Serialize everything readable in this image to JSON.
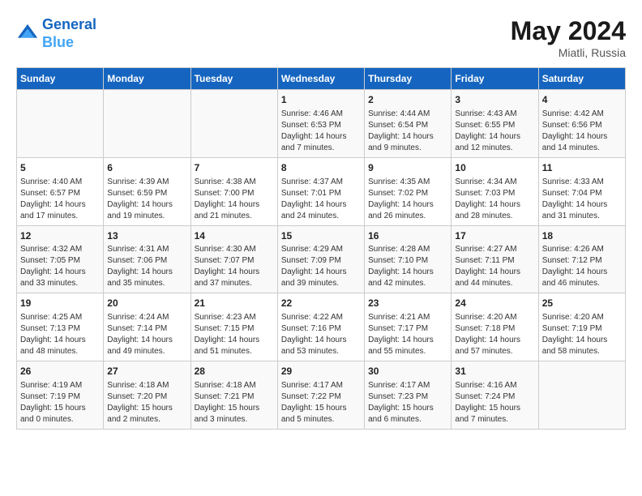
{
  "header": {
    "logo_line1": "General",
    "logo_line2": "Blue",
    "month_title": "May 2024",
    "subtitle": "Miatli, Russia"
  },
  "days_of_week": [
    "Sunday",
    "Monday",
    "Tuesday",
    "Wednesday",
    "Thursday",
    "Friday",
    "Saturday"
  ],
  "weeks": [
    [
      {
        "num": "",
        "info": ""
      },
      {
        "num": "",
        "info": ""
      },
      {
        "num": "",
        "info": ""
      },
      {
        "num": "1",
        "info": "Sunrise: 4:46 AM\nSunset: 6:53 PM\nDaylight: 14 hours\nand 7 minutes."
      },
      {
        "num": "2",
        "info": "Sunrise: 4:44 AM\nSunset: 6:54 PM\nDaylight: 14 hours\nand 9 minutes."
      },
      {
        "num": "3",
        "info": "Sunrise: 4:43 AM\nSunset: 6:55 PM\nDaylight: 14 hours\nand 12 minutes."
      },
      {
        "num": "4",
        "info": "Sunrise: 4:42 AM\nSunset: 6:56 PM\nDaylight: 14 hours\nand 14 minutes."
      }
    ],
    [
      {
        "num": "5",
        "info": "Sunrise: 4:40 AM\nSunset: 6:57 PM\nDaylight: 14 hours\nand 17 minutes."
      },
      {
        "num": "6",
        "info": "Sunrise: 4:39 AM\nSunset: 6:59 PM\nDaylight: 14 hours\nand 19 minutes."
      },
      {
        "num": "7",
        "info": "Sunrise: 4:38 AM\nSunset: 7:00 PM\nDaylight: 14 hours\nand 21 minutes."
      },
      {
        "num": "8",
        "info": "Sunrise: 4:37 AM\nSunset: 7:01 PM\nDaylight: 14 hours\nand 24 minutes."
      },
      {
        "num": "9",
        "info": "Sunrise: 4:35 AM\nSunset: 7:02 PM\nDaylight: 14 hours\nand 26 minutes."
      },
      {
        "num": "10",
        "info": "Sunrise: 4:34 AM\nSunset: 7:03 PM\nDaylight: 14 hours\nand 28 minutes."
      },
      {
        "num": "11",
        "info": "Sunrise: 4:33 AM\nSunset: 7:04 PM\nDaylight: 14 hours\nand 31 minutes."
      }
    ],
    [
      {
        "num": "12",
        "info": "Sunrise: 4:32 AM\nSunset: 7:05 PM\nDaylight: 14 hours\nand 33 minutes."
      },
      {
        "num": "13",
        "info": "Sunrise: 4:31 AM\nSunset: 7:06 PM\nDaylight: 14 hours\nand 35 minutes."
      },
      {
        "num": "14",
        "info": "Sunrise: 4:30 AM\nSunset: 7:07 PM\nDaylight: 14 hours\nand 37 minutes."
      },
      {
        "num": "15",
        "info": "Sunrise: 4:29 AM\nSunset: 7:09 PM\nDaylight: 14 hours\nand 39 minutes."
      },
      {
        "num": "16",
        "info": "Sunrise: 4:28 AM\nSunset: 7:10 PM\nDaylight: 14 hours\nand 42 minutes."
      },
      {
        "num": "17",
        "info": "Sunrise: 4:27 AM\nSunset: 7:11 PM\nDaylight: 14 hours\nand 44 minutes."
      },
      {
        "num": "18",
        "info": "Sunrise: 4:26 AM\nSunset: 7:12 PM\nDaylight: 14 hours\nand 46 minutes."
      }
    ],
    [
      {
        "num": "19",
        "info": "Sunrise: 4:25 AM\nSunset: 7:13 PM\nDaylight: 14 hours\nand 48 minutes."
      },
      {
        "num": "20",
        "info": "Sunrise: 4:24 AM\nSunset: 7:14 PM\nDaylight: 14 hours\nand 49 minutes."
      },
      {
        "num": "21",
        "info": "Sunrise: 4:23 AM\nSunset: 7:15 PM\nDaylight: 14 hours\nand 51 minutes."
      },
      {
        "num": "22",
        "info": "Sunrise: 4:22 AM\nSunset: 7:16 PM\nDaylight: 14 hours\nand 53 minutes."
      },
      {
        "num": "23",
        "info": "Sunrise: 4:21 AM\nSunset: 7:17 PM\nDaylight: 14 hours\nand 55 minutes."
      },
      {
        "num": "24",
        "info": "Sunrise: 4:20 AM\nSunset: 7:18 PM\nDaylight: 14 hours\nand 57 minutes."
      },
      {
        "num": "25",
        "info": "Sunrise: 4:20 AM\nSunset: 7:19 PM\nDaylight: 14 hours\nand 58 minutes."
      }
    ],
    [
      {
        "num": "26",
        "info": "Sunrise: 4:19 AM\nSunset: 7:19 PM\nDaylight: 15 hours\nand 0 minutes."
      },
      {
        "num": "27",
        "info": "Sunrise: 4:18 AM\nSunset: 7:20 PM\nDaylight: 15 hours\nand 2 minutes."
      },
      {
        "num": "28",
        "info": "Sunrise: 4:18 AM\nSunset: 7:21 PM\nDaylight: 15 hours\nand 3 minutes."
      },
      {
        "num": "29",
        "info": "Sunrise: 4:17 AM\nSunset: 7:22 PM\nDaylight: 15 hours\nand 5 minutes."
      },
      {
        "num": "30",
        "info": "Sunrise: 4:17 AM\nSunset: 7:23 PM\nDaylight: 15 hours\nand 6 minutes."
      },
      {
        "num": "31",
        "info": "Sunrise: 4:16 AM\nSunset: 7:24 PM\nDaylight: 15 hours\nand 7 minutes."
      },
      {
        "num": "",
        "info": ""
      }
    ]
  ]
}
